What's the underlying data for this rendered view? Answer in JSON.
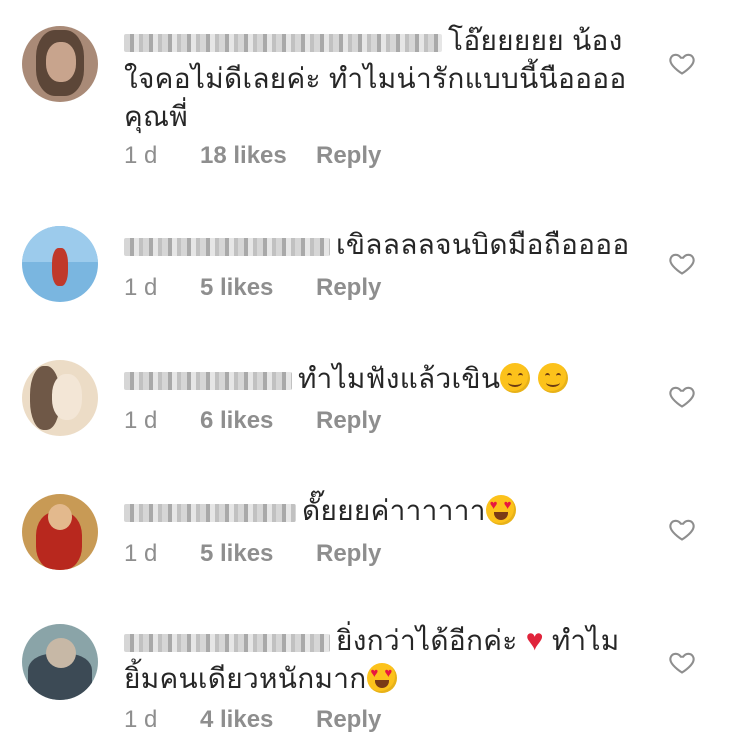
{
  "comments": [
    {
      "text_lines": [
        "โอ๊ยยยยย น้อง",
        "ใจคอไม่ดีเลยค่ะ ทำไมน่ารักแบบนี้นืออออ",
        "คุณพี่"
      ],
      "time": "1 d",
      "likes": "18 likes",
      "reply": "Reply"
    },
    {
      "text_lines": [
        "เขิลลลลจนบิดมือถืออออ"
      ],
      "time": "1 d",
      "likes": "5 likes",
      "reply": "Reply"
    },
    {
      "text_lines": [
        "ทำไมฟังแล้วเขิน"
      ],
      "emoji": [
        "smiling-face",
        "smiling-face"
      ],
      "time": "1 d",
      "likes": "6 likes",
      "reply": "Reply"
    },
    {
      "text_lines": [
        "ดั๊ยยยค่าาาาาา"
      ],
      "emoji": [
        "heart-eyes-face"
      ],
      "time": "1 d",
      "likes": "5 likes",
      "reply": "Reply"
    },
    {
      "text_lines": [
        "ยิ่งกว่าได้อีกค่ะ",
        "ทำไม",
        "ยิ้มคนเดียวหนักมาก"
      ],
      "emoji": [
        "red-heart",
        "heart-eyes-face"
      ],
      "time": "1 d",
      "likes": "4 likes",
      "reply": "Reply"
    }
  ],
  "colors": {
    "text": "#262626",
    "meta": "#8e8e8e",
    "heart_outline": "#8e8e8e"
  },
  "icons": [
    "heart-outline-icon",
    "avatar-blurred"
  ]
}
